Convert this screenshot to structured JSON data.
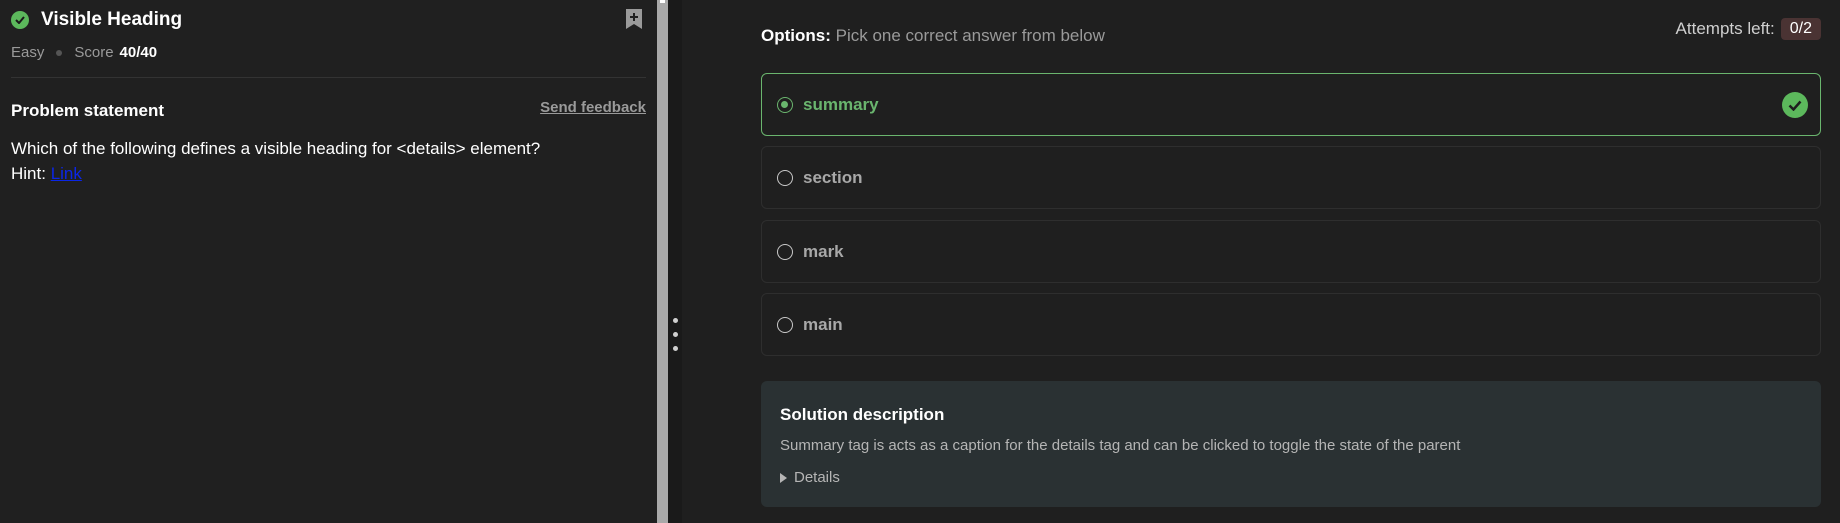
{
  "problem": {
    "title": "Visible Heading",
    "difficulty": "Easy",
    "score_label": "Score",
    "score_value": "40/40",
    "statement_heading": "Problem statement",
    "feedback_label": "Send feedback",
    "question": "Which of the following defines a visible heading for <details> element?",
    "hint_label": "Hint:",
    "hint_link": "Link"
  },
  "options": {
    "label_bold": "Options:",
    "label_text": "Pick one correct answer from below",
    "attempts_label": "Attempts left:",
    "attempts_value": "0/2",
    "items": [
      {
        "label": "summary",
        "selected": true,
        "correct": true
      },
      {
        "label": "section",
        "selected": false,
        "correct": false
      },
      {
        "label": "mark",
        "selected": false,
        "correct": false
      },
      {
        "label": "main",
        "selected": false,
        "correct": false
      }
    ]
  },
  "solution": {
    "title": "Solution description",
    "text": "Summary tag is acts as a caption for the details tag and can be clicked to toggle the state of the parent",
    "details_label": "Details"
  },
  "colors": {
    "success": "#5cb85c",
    "correct_border": "#6ab56e",
    "hint_link": "#0b26e6",
    "attempts_badge": "#4a3333"
  },
  "icons": {
    "status": "check-circle-icon",
    "bookmark": "bookmark-add-icon",
    "correct": "check-circle-icon",
    "details": "triangle-right-icon"
  }
}
